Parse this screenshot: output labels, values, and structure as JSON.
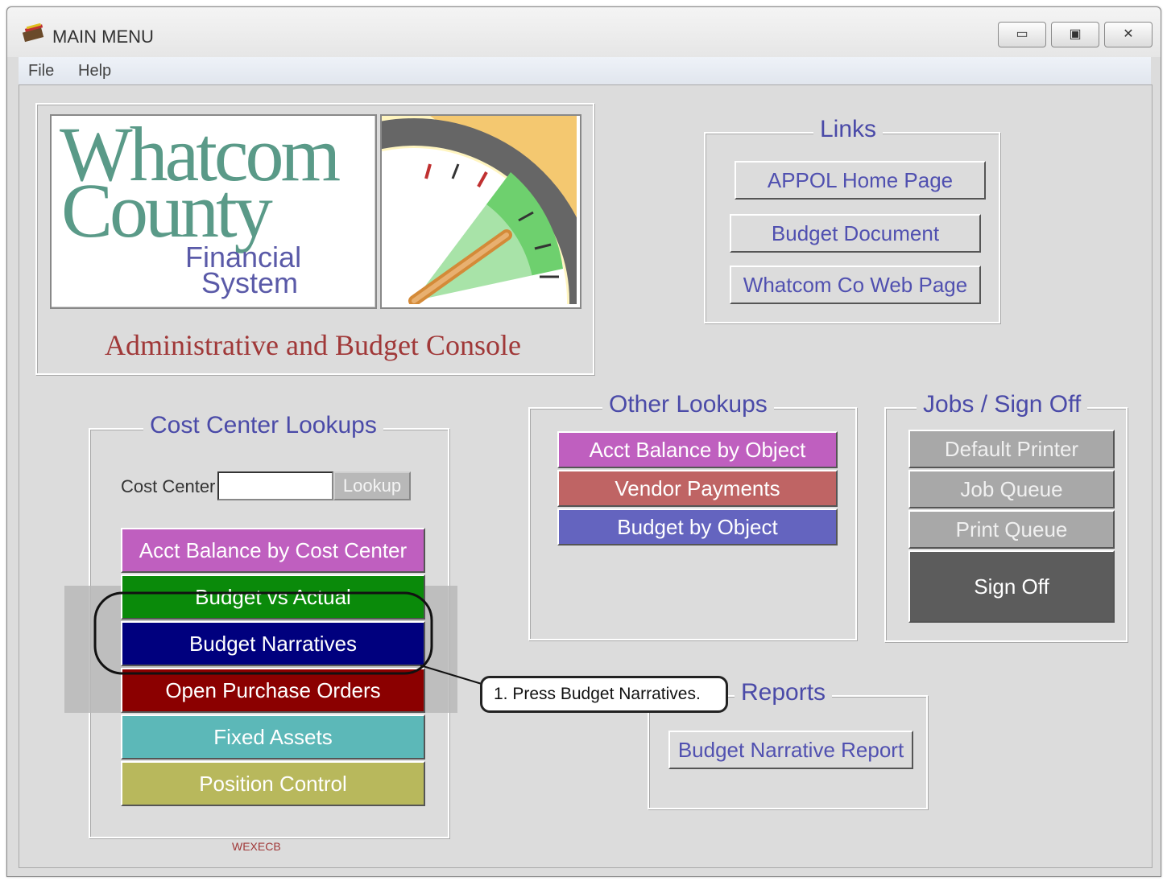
{
  "window": {
    "title": "MAIN MENU",
    "controls": {
      "minimize": "▭",
      "maximize": "▣",
      "close": "✕"
    }
  },
  "menu": {
    "items": [
      "File",
      "Help"
    ]
  },
  "logo": {
    "line1": "Whatcom",
    "line2": "County",
    "line3": "Financial",
    "line4": "System",
    "subtitle": "Administrative and Budget Console"
  },
  "links": {
    "title": "Links",
    "buttons": [
      "APPOL Home Page",
      "Budget Document",
      "Whatcom Co Web Page"
    ]
  },
  "cost_center": {
    "title": "Cost Center Lookups",
    "field_label": "Cost Center",
    "field_value": "",
    "lookup_label": "Lookup",
    "buttons": [
      {
        "label": "Acct Balance by Cost Center",
        "bg": "#bf5fbf",
        "fg": "#ffffff"
      },
      {
        "label": "Budget vs Actual",
        "bg": "#0a8a0a",
        "fg": "#ffffff"
      },
      {
        "label": "Budget Narratives",
        "bg": "#00007e",
        "fg": "#ffffff"
      },
      {
        "label": "Open Purchase Orders",
        "bg": "#8b0000",
        "fg": "#ffffff"
      },
      {
        "label": "Fixed Assets",
        "bg": "#5cb8b8",
        "fg": "#ffffff"
      },
      {
        "label": "Position Control",
        "bg": "#b8b85c",
        "fg": "#ffffff"
      }
    ],
    "footer": "WEXECB"
  },
  "other_lookups": {
    "title": "Other Lookups",
    "buttons": [
      {
        "label": "Acct Balance by Object",
        "bg": "#bf5fbf",
        "fg": "#ffffff"
      },
      {
        "label": "Vendor Payments",
        "bg": "#bf6464",
        "fg": "#ffffff"
      },
      {
        "label": "Budget by Object",
        "bg": "#6464bf",
        "fg": "#ffffff"
      }
    ]
  },
  "jobs": {
    "title": "Jobs / Sign Off",
    "buttons": [
      {
        "label": "Default Printer",
        "bg": "#a8a8a8",
        "fg": "#f0f0f0"
      },
      {
        "label": "Job Queue",
        "bg": "#a8a8a8",
        "fg": "#f0f0f0"
      },
      {
        "label": "Print Queue",
        "bg": "#a8a8a8",
        "fg": "#f0f0f0"
      },
      {
        "label": "Sign Off",
        "bg": "#5c5c5c",
        "fg": "#ffffff"
      }
    ]
  },
  "reports": {
    "title": "Reports",
    "buttons": [
      "Budget Narrative Report"
    ]
  },
  "callout": {
    "text": "1. Press Budget Narratives."
  }
}
